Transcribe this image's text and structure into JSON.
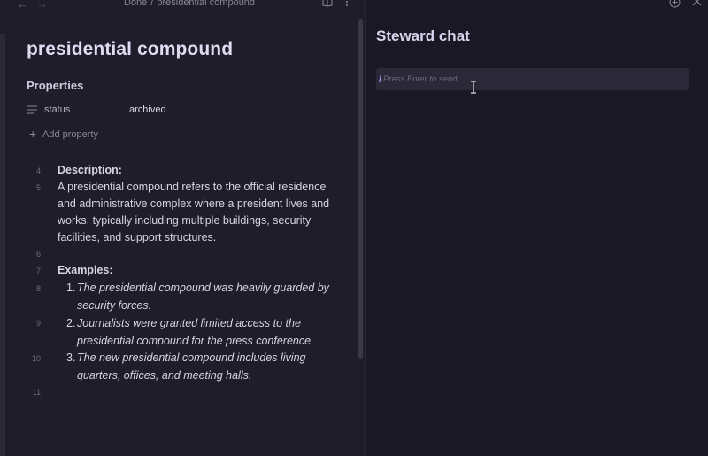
{
  "nav": {
    "breadcrumb_parent": "Done",
    "breadcrumb_sep": "/",
    "breadcrumb_current": "presidential compound"
  },
  "note": {
    "title": "presidential compound",
    "properties_heading": "Properties",
    "property": {
      "key": "status",
      "value": "archived"
    },
    "add_property_label": "Add property",
    "lines": {
      "n4": "4",
      "n5": "5",
      "n6": "6",
      "n7": "7",
      "n8": "8",
      "n9": "9",
      "n10": "10",
      "n11": "11",
      "description_heading": "Description:",
      "description_text": "A presidential compound refers to the official residence and administrative complex where a president lives and works, typically including multiple buildings, security facilities, and support structures.",
      "examples_heading": "Examples:",
      "example1_num": "1.",
      "example1": "The presidential compound was heavily guarded by security forces.",
      "example2_num": "2.",
      "example2": "Journalists were granted limited access to the presidential compound for the press conference.",
      "example3_num": "3.",
      "example3": "The new presidential compound includes living quarters, offices, and meeting halls."
    }
  },
  "chat": {
    "title": "Steward chat",
    "caret_mark": "/",
    "input_placeholder": "Press Enter to send",
    "input_value": ""
  },
  "icons": {
    "back": "arrow-left-icon",
    "forward": "arrow-right-icon",
    "reading_mode": "book-open-icon",
    "more": "more-vertical-icon",
    "property_type": "text-lines-icon",
    "add": "plus-icon",
    "new_tab": "plus-circle-icon",
    "close": "close-icon",
    "text_cursor": "i-beam-cursor-icon"
  },
  "colors": {
    "accent": "#a99bf2",
    "background_left": "#1e1d29",
    "background_right": "#1a1824",
    "input_bg": "#2b2937"
  }
}
